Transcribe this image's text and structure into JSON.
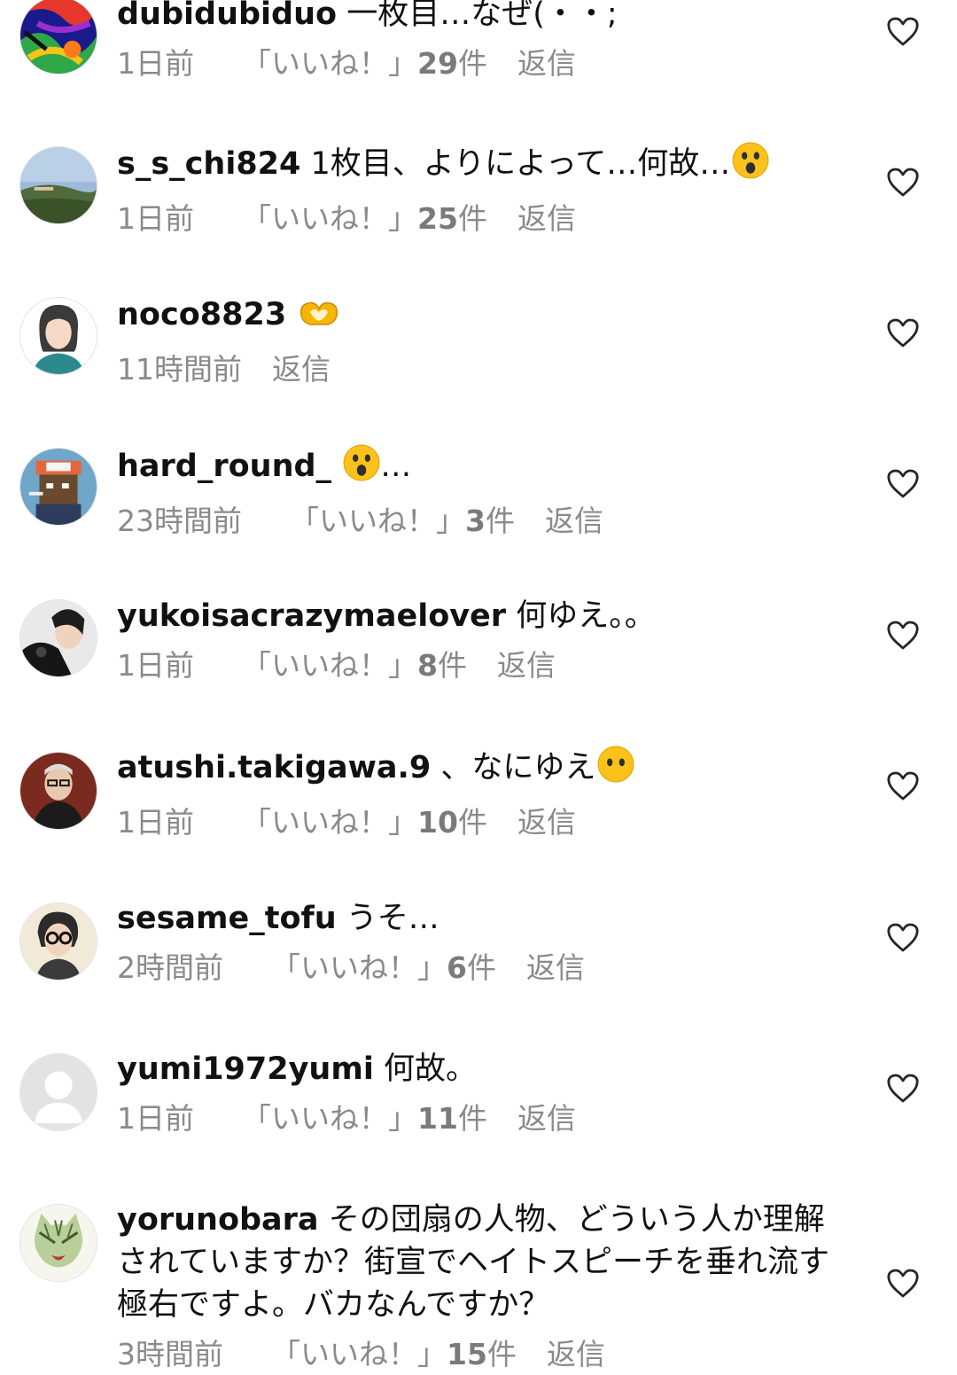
{
  "labels": {
    "likes_open": "「いいね！」",
    "likes_suffix": "件",
    "reply": "返信"
  },
  "comments": [
    {
      "username": "dubidubiduo",
      "text": "一枚目…なぜ(・・;",
      "time": "1日前",
      "likes": "29",
      "avatar": "abstract-color-avatar",
      "emoji": ""
    },
    {
      "username": "s_s_chi824",
      "text": "1枚目、よりによって…何故…",
      "time": "1日前",
      "likes": "25",
      "avatar": "landscape-avatar",
      "emoji": "astonished-face-emoji"
    },
    {
      "username": "noco8823",
      "text": "",
      "time": "11時間前",
      "likes": "",
      "avatar": "illustrated-woman-avatar",
      "emoji": "heart-hands-emoji"
    },
    {
      "username": "hard_round_",
      "text": "…",
      "time": "23時間前",
      "likes": "3",
      "avatar": "pixel-art-avatar",
      "emoji": "astonished-face-emoji"
    },
    {
      "username": "yukoisacrazymaelover",
      "text": "何ゆえ。。",
      "time": "1日前",
      "likes": "8",
      "avatar": "photo-avatar",
      "emoji": ""
    },
    {
      "username": "atushi.takigawa.9",
      "text": "、なにゆえ",
      "time": "1日前",
      "likes": "10",
      "avatar": "portrait-avatar",
      "emoji": "no-mouth-face-emoji"
    },
    {
      "username": "sesame_tofu",
      "text": "うそ…",
      "time": "2時間前",
      "likes": "6",
      "avatar": "glasses-woman-avatar",
      "emoji": ""
    },
    {
      "username": "yumi1972yumi",
      "text": "何故。",
      "time": "1日前",
      "likes": "11",
      "avatar": "default-avatar",
      "emoji": ""
    },
    {
      "username": "yorunobara",
      "text": "その団扇の人物、どういう人か理解されていますか？街宣でヘイトスピーチを垂れ流す極右ですよ。バカなんですか？",
      "time": "3時間前",
      "likes": "15",
      "avatar": "cat-illustration-avatar",
      "emoji": ""
    }
  ]
}
